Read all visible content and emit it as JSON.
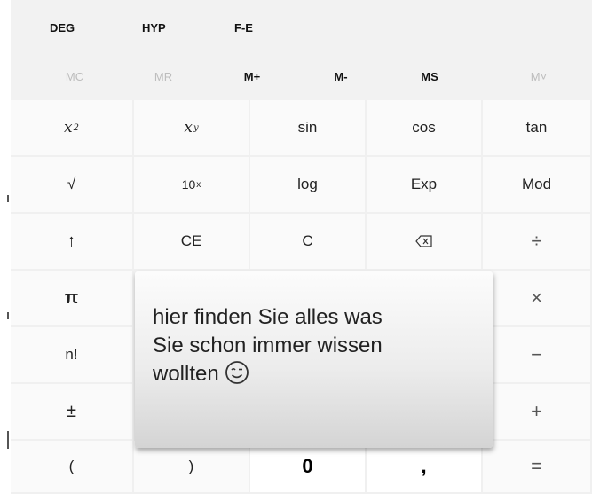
{
  "modes": {
    "deg": "DEG",
    "hyp": "HYP",
    "fe": "F-E"
  },
  "memory": [
    {
      "label": "MC",
      "enabled": false
    },
    {
      "label": "MR",
      "enabled": false
    },
    {
      "label": "M+",
      "enabled": true
    },
    {
      "label": "M-",
      "enabled": true
    },
    {
      "label": "MS",
      "enabled": true
    },
    {
      "label": "M˅",
      "enabled": false
    }
  ],
  "keys": {
    "square_base": "x",
    "square_exp": "2",
    "power_base": "x",
    "power_exp": "y",
    "sin": "sin",
    "cos": "cos",
    "tan": "tan",
    "sqrt": "√",
    "tenpow_base": "10",
    "tenpow_exp": "x",
    "log": "log",
    "exp": "Exp",
    "mod": "Mod",
    "up": "↑",
    "ce": "CE",
    "c": "C",
    "backspace": "⌫",
    "divide": "÷",
    "pi": "π",
    "multiply": "×",
    "factorial": "n!",
    "minus": "−",
    "negate": "±",
    "plus": "+",
    "lparen": "(",
    "rparen": ")",
    "zero": "0",
    "decimal": ",",
    "equals": "="
  },
  "tooltip": {
    "line1": "hier finden Sie alles was",
    "line2": "Sie schon immer wissen",
    "line3": "wollten",
    "emoji_icon": "winking-face-icon"
  },
  "colors": {
    "key_bg": "#fafafa",
    "panel_bg": "#f2f2f2",
    "number_key_bg": "#ffffff"
  }
}
